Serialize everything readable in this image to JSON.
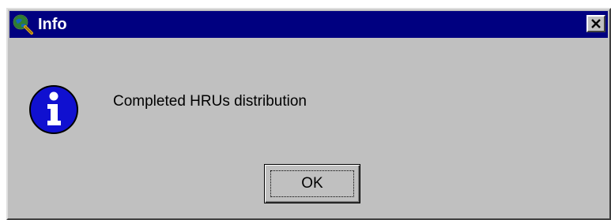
{
  "window": {
    "title": "Info",
    "title_bar_color": "#000080",
    "background_color": "#c0c0c0"
  },
  "titlebar": {
    "app_icon": "globe-magnifier-icon",
    "close_icon": "close-icon"
  },
  "body": {
    "icon": "info-icon",
    "icon_color": "#1010d0",
    "message": "Completed HRUs distribution"
  },
  "buttons": {
    "ok_label": "OK"
  }
}
